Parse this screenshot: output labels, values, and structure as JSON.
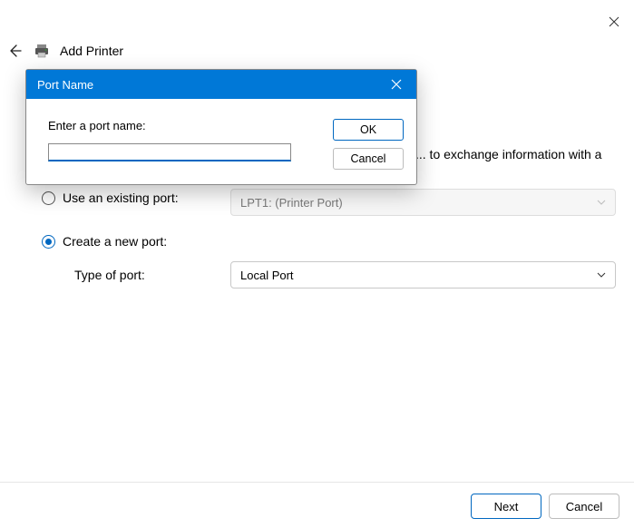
{
  "window": {
    "title": "Add Printer"
  },
  "partial_text": "... to exchange information with a",
  "existing_port": {
    "label": "Use an existing port:",
    "value": "LPT1: (Printer Port)",
    "checked": false
  },
  "new_port": {
    "label": "Create a new port:",
    "type_label": "Type of port:",
    "type_value": "Local Port",
    "checked": true
  },
  "footer": {
    "next": "Next",
    "cancel": "Cancel"
  },
  "modal": {
    "title": "Port Name",
    "label": "Enter a port name:",
    "input_value": "",
    "ok": "OK",
    "cancel": "Cancel"
  }
}
